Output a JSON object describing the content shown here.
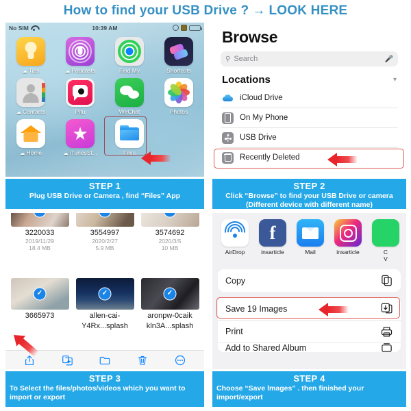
{
  "title": {
    "text_before": "How to find your USB Drive ?",
    "arrow": "→",
    "text_after": "LOOK HERE",
    "color": "#3490c4"
  },
  "theme": {
    "band_blue": "#25a8e8",
    "accent_red": "#e8252a",
    "highlight_border": "#e05a52",
    "ios_blue": "#0a84ff",
    "check_blue": "#1b84e7"
  },
  "steps": [
    {
      "id": "step1",
      "title": "STEP 1",
      "desc": "Plug USB Drive or Camera , find “Files” App"
    },
    {
      "id": "step2",
      "title": "STEP 2",
      "desc": "Click “Browse” to find your USB Drive or camera\n(Different device with different name)"
    },
    {
      "id": "step3",
      "title": "STEP 3",
      "desc": "To Select the files/photos/videos which you want to import or export"
    },
    {
      "id": "step4",
      "title": "STEP 4",
      "desc": "Choose “Save lmages” . then finished your import/export"
    }
  ],
  "homescreen": {
    "statusbar": {
      "carrier": "No SIM",
      "wifi_icon": "wifi-icon",
      "time": "10:39 AM",
      "location_icon": "location-icon",
      "alarm_icon": "alarm-icon",
      "battery_icon": "battery-charging-icon"
    },
    "apps": [
      {
        "label": "Tips",
        "icon": "tips-icon",
        "cloud": true
      },
      {
        "label": "Podcasts",
        "icon": "podcasts-icon",
        "cloud": true
      },
      {
        "label": "Find My",
        "icon": "find-my-icon",
        "cloud": false
      },
      {
        "label": "Shortcuts",
        "icon": "shortcuts-icon",
        "cloud": false
      },
      {
        "label": "Contacts",
        "icon": "contacts-icon",
        "cloud": true
      },
      {
        "label": "Pitu",
        "icon": "pitu-icon",
        "cloud": false
      },
      {
        "label": "WeChat",
        "icon": "wechat-icon",
        "cloud": false
      },
      {
        "label": "Photos",
        "icon": "photos-icon",
        "cloud": false
      },
      {
        "label": "Home",
        "icon": "home-icon",
        "cloud": true
      },
      {
        "label": "iTunesSt...",
        "icon": "itunes-store-icon",
        "cloud": true
      },
      {
        "label": "Files",
        "icon": "files-icon",
        "cloud": false,
        "highlighted": true
      },
      {
        "label": "",
        "icon": "",
        "cloud": false
      }
    ]
  },
  "browse": {
    "heading": "Browse",
    "search": {
      "placeholder": "Search",
      "icon": "search-icon",
      "mic_icon": "microphone-icon"
    },
    "locations_header": "Locations",
    "collapse_icon": "chevron-down-icon",
    "locations": [
      {
        "label": "iCloud Drive",
        "icon": "icloud-drive-icon",
        "highlighted": false
      },
      {
        "label": "On My Phone",
        "icon": "phone-icon",
        "highlighted": false
      },
      {
        "label": "USB Drive",
        "icon": "usb-icon",
        "highlighted": true
      },
      {
        "label": "Recently Deleted",
        "icon": "trash-icon",
        "highlighted": false
      }
    ]
  },
  "filegrid": {
    "row1": [
      {
        "name": "3220033",
        "date": "2019/11/29",
        "size": "18.4 MB",
        "selected": true
      },
      {
        "name": "3554997",
        "date": "2020/2/27",
        "size": "5.9 MB",
        "selected": true
      },
      {
        "name": "3574692",
        "date": "2020/3/5",
        "size": "10 MB",
        "selected": true
      }
    ],
    "row2": [
      {
        "name": "3665973",
        "name2": "",
        "selected": true
      },
      {
        "name": "allen-cai-",
        "name2": "Y4Rx...splash",
        "selected": true
      },
      {
        "name": "aronpw-0caik",
        "name2": "kln3A...splash",
        "selected": true
      }
    ],
    "toolbar": [
      {
        "name": "share",
        "icon": "share-icon"
      },
      {
        "name": "duplicate",
        "icon": "duplicate-icon"
      },
      {
        "name": "new-folder",
        "icon": "folder-icon"
      },
      {
        "name": "delete",
        "icon": "trash-icon"
      },
      {
        "name": "more",
        "icon": "more-ellipsis-icon"
      }
    ],
    "check_glyph": "✓"
  },
  "sharesheet": {
    "apps": [
      {
        "label": "AirDrop",
        "icon": "airdrop-icon"
      },
      {
        "label": "insarticle",
        "icon": "facebook-icon"
      },
      {
        "label": "Mail",
        "icon": "mail-icon"
      },
      {
        "label": "insarticle",
        "icon": "instagram-icon"
      },
      {
        "label": "C\nV",
        "icon": "green-app-icon"
      }
    ],
    "actions": [
      {
        "label": "Copy",
        "icon": "copy-icon",
        "highlighted": false
      },
      {
        "label": "Save 19 Images",
        "icon": "save-images-icon",
        "highlighted": true
      },
      {
        "label": "Print",
        "icon": "print-icon",
        "highlighted": false
      },
      {
        "label": "Add to Shared Album",
        "icon": "shared-album-icon",
        "highlighted": false
      }
    ]
  }
}
